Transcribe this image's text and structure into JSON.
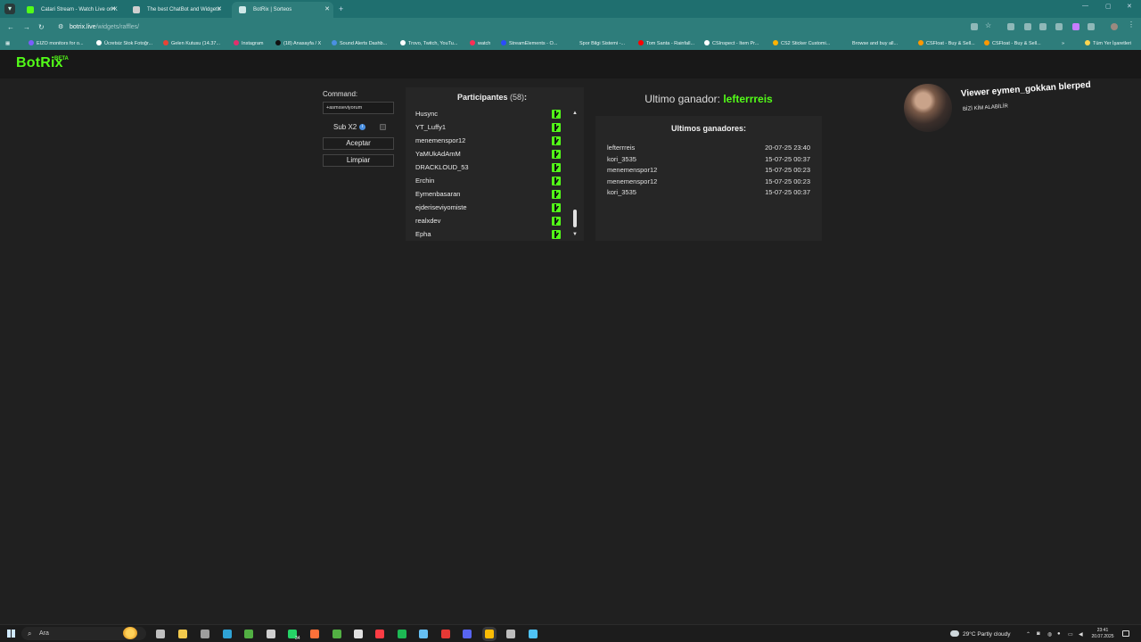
{
  "browser": {
    "tabs": [
      {
        "title": "Catari Stream - Watch Live on K",
        "favicon_color": "#53fc18",
        "active": false
      },
      {
        "title": "The best ChatBot and Widgets",
        "favicon_color": "#cfcfcf",
        "active": false
      },
      {
        "title": "BotRix | Sorteos",
        "favicon_color": "#cfe8e8",
        "active": true
      }
    ],
    "new_tab": "+",
    "url_host": "botrix.live",
    "url_path": "/widgets/raffles/",
    "bookmarks": [
      {
        "label": "EIZO monitors for o...",
        "color": "#7b5cff"
      },
      {
        "label": "Ücretsiz Stok Fotoğr...",
        "color": "#ffffff"
      },
      {
        "label": "Gelen Kutusu (14.37...",
        "color": "#ea4335"
      },
      {
        "label": "Instagram",
        "color": "#e1306c"
      },
      {
        "label": "(18) Anasayfa / X",
        "color": "#111111"
      },
      {
        "label": "Sound Alerts Dashb...",
        "color": "#4a90e2"
      },
      {
        "label": "Trovo, Twitch, YouTu...",
        "color": "#ffffff"
      },
      {
        "label": "watch",
        "color": "#ff2d55"
      },
      {
        "label": "StreamElements - O...",
        "color": "#2b4bff"
      },
      {
        "label": "Spor Bilgi Sistemi -...",
        "color": "#2e7d7b"
      },
      {
        "label": "Tom Santa - Rainfall...",
        "color": "#ff0000"
      },
      {
        "label": "CSInspect - Item Pr...",
        "color": "#ffffff"
      },
      {
        "label": "CS2 Sticker Customi...",
        "color": "#ffb300"
      },
      {
        "label": "Browse and buy all...",
        "color": "#2e7d7b"
      },
      {
        "label": "CSFloat - Buy & Sell...",
        "color": "#ff9800"
      },
      {
        "label": "CSFloat - Buy & Sell...",
        "color": "#ff9800"
      },
      {
        "label": "Tüm Yer İşaretleri",
        "color": "#ffd54f"
      }
    ],
    "bookmarks_more": "»"
  },
  "app": {
    "logo": "BotRix",
    "logo_badge": "BETA",
    "accent": "#53fc18"
  },
  "raffle": {
    "command_label": "Command:",
    "command_value": "+asmıseviyorum",
    "sub_label": "Sub X2",
    "info_glyph": "i",
    "accept_label": "Aceptar",
    "clear_label": "Limpiar"
  },
  "participants": {
    "title": "Participantes",
    "count": "(58)",
    "colon": ":",
    "names": [
      "Husync",
      "YT_Luffy1",
      "menemenspor12",
      "YaMUkAdAmM",
      "DRACKLOUD_53",
      "Erchin",
      "Eymenbasaran",
      "ejderiseviyomiste",
      "realxdev",
      "Epha"
    ],
    "scroll_position": 0.95
  },
  "winners": {
    "last_label": "Ultimo ganador:",
    "last_name": "lefterrreis",
    "list_title": "Ultimos ganadores:",
    "rows": [
      {
        "name": "lefterrreis",
        "date": "20-07-25 23:40"
      },
      {
        "name": "kori_3535",
        "date": "15-07-25 00:37"
      },
      {
        "name": "menemenspor12",
        "date": "15-07-25 00:23"
      },
      {
        "name": "menemenspor12",
        "date": "15-07-25 00:23"
      },
      {
        "name": "kori_3535",
        "date": "15-07-25 00:37"
      }
    ]
  },
  "alert": {
    "title": "Viewer eymen_gokkan blerped",
    "subtitle": "BİZİ KİM ALABİLİR"
  },
  "taskbar": {
    "search_placeholder": "Ara",
    "weather": "29°C  Partly cloudy",
    "time": "23:41",
    "date": "20.07.2025",
    "whatsapp_badge": "34",
    "apps": [
      {
        "name": "task-view",
        "color": "#bfbfbf"
      },
      {
        "name": "file-explorer",
        "color": "#f2c94c"
      },
      {
        "name": "settings",
        "color": "#9e9e9e"
      },
      {
        "name": "edge",
        "color": "#2fa3d6"
      },
      {
        "name": "xbox",
        "color": "#52b043"
      },
      {
        "name": "mail",
        "color": "#cfcfcf"
      },
      {
        "name": "whatsapp",
        "color": "#25d366"
      },
      {
        "name": "firefox",
        "color": "#ff7139"
      },
      {
        "name": "xbox-app",
        "color": "#52b043"
      },
      {
        "name": "epic-games",
        "color": "#e0e0e0"
      },
      {
        "name": "music",
        "color": "#fc3c44"
      },
      {
        "name": "spotify",
        "color": "#1db954"
      },
      {
        "name": "steam",
        "color": "#66c0f4"
      },
      {
        "name": "recorder",
        "color": "#e53935"
      },
      {
        "name": "discord",
        "color": "#5865f2"
      },
      {
        "name": "chrome",
        "color": "#fbbc05"
      },
      {
        "name": "obs",
        "color": "#bdbdbd"
      },
      {
        "name": "vpn",
        "color": "#4fc3f7"
      }
    ]
  }
}
